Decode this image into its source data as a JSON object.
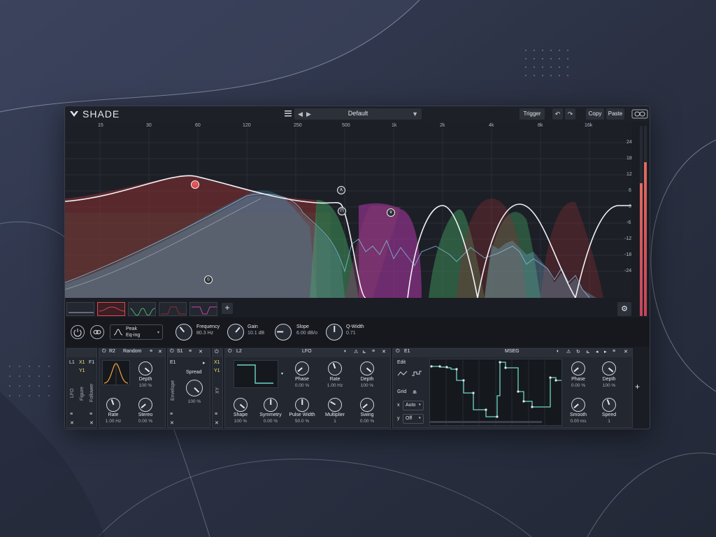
{
  "app": {
    "name": "SHADE"
  },
  "header": {
    "preset_name": "Default",
    "prev": "◀",
    "next": "▶",
    "dropdown": "▼",
    "trigger": "Trigger",
    "undo": "↶",
    "redo": "↷",
    "copy": "Copy",
    "paste": "Paste"
  },
  "spectrum": {
    "freq_labels": [
      "15",
      "30",
      "60",
      "120",
      "250",
      "500",
      "1k",
      "2k",
      "4k",
      "8k",
      "16k"
    ],
    "db_labels": [
      "24",
      "18",
      "12",
      "6",
      "0",
      "-6",
      "-12",
      "-18",
      "-24"
    ],
    "nodes": [
      {
        "symbol": "∩",
        "color": "#e0494c"
      },
      {
        "symbol": "∧",
        "color": "#2a2e37"
      },
      {
        "symbol": "⊓",
        "color": "#2a2e37"
      },
      {
        "symbol": "∨",
        "color": "#2a2e37"
      },
      {
        "symbol": "⦸",
        "color": "#2a2e37"
      }
    ],
    "add_band": "+",
    "settings_icon": "⚙"
  },
  "band": {
    "type_line1": "Peak",
    "type_line2": "Eq-ing",
    "frequency_label": "Frequency",
    "frequency_value": "80.3 Hz",
    "gain_label": "Gain",
    "gain_value": "10.1 dB",
    "slope_label": "Slope",
    "slope_value": "6.00 dB/o",
    "qwidth_label": "Q-Width",
    "qwidth_value": "0.71"
  },
  "modules": {
    "sources": {
      "l1": "L1",
      "x1": "X1",
      "f1": "F1",
      "y1": "Y1",
      "lfo": "LFO",
      "figure": "Figure",
      "follower": "Follower"
    },
    "random": {
      "id": "R2",
      "title": "Random",
      "depth_label": "Depth",
      "depth_value": "100 %",
      "rate_label": "Rate",
      "rate_value": "1.00 Hz",
      "stereo_label": "Stereo",
      "stereo_value": "0.00 %"
    },
    "spread": {
      "e1": "E1",
      "s1": "S1",
      "x1": "X1",
      "y1": "Y1",
      "envelope": "Envelope",
      "xy": "XY",
      "label": "Spread",
      "value": "100 %"
    },
    "lfo": {
      "id": "L2",
      "title": "LFO",
      "phase_label": "Phase",
      "phase_value": "0.00 %",
      "rate_label": "Rate",
      "rate_value": "1.00 Hz",
      "depth_label": "Depth",
      "depth_value": "100 %",
      "shape_label": "Shape",
      "shape_value": "100 %",
      "symmetry_label": "Symmetry",
      "symmetry_value": "0.00 %",
      "pulse_label": "Pulse Width",
      "pulse_value": "50.0 %",
      "multiplier_label": "Multiplier",
      "multiplier_value": "1",
      "swing_label": "Swing",
      "swing_value": "0.00 %"
    },
    "mseg": {
      "id": "E1",
      "title": "MSEG",
      "edit": "Edit",
      "grid": "Grid",
      "x_label": "x",
      "x_value": "Auto",
      "y_label": "y",
      "y_value": "Off",
      "phase_label": "Phase",
      "phase_value": "0.00 %",
      "depth_label": "Depth",
      "depth_value": "100 %",
      "smooth_label": "Smooth",
      "smooth_value": "0.00 ms",
      "speed_label": "Speed",
      "speed_value": "1"
    },
    "add": "+",
    "scroll": "▲"
  },
  "colors": {
    "accent_yellow": "#f1e27a",
    "band_red": "#e0494c",
    "band_green": "#4caf6a",
    "band_magenta": "#c447a8",
    "spectrum_blue": "#7fb7d6"
  }
}
